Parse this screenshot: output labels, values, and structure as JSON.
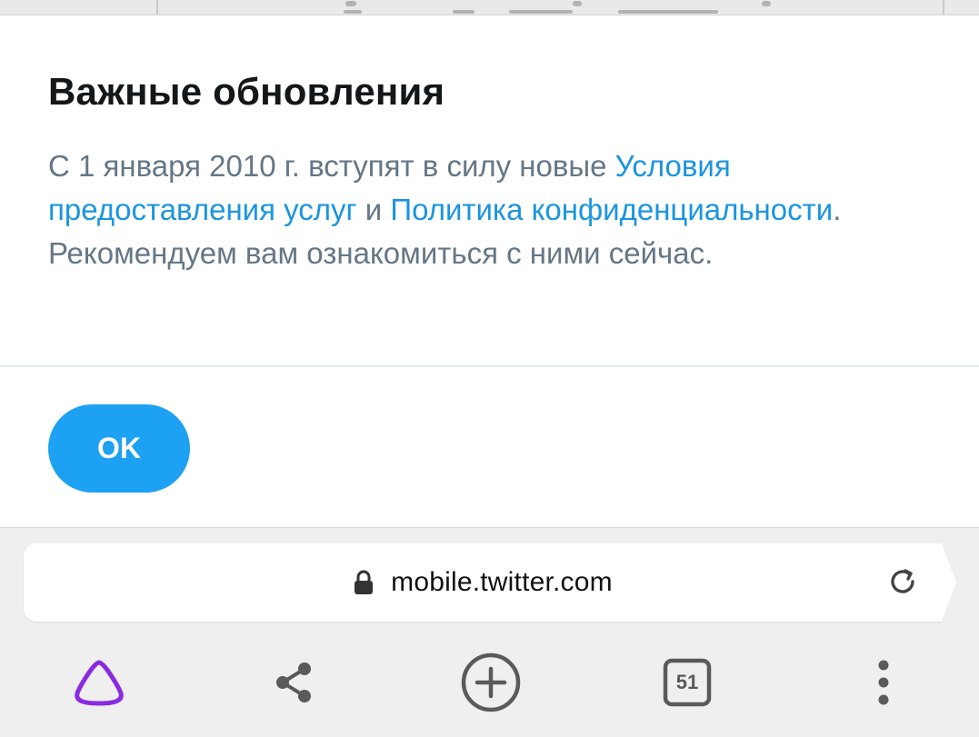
{
  "dialog": {
    "title": "Важные обновления",
    "body_pre": "С 1 января 2010 г. вступят в силу новые ",
    "terms_link": "Условия предоставления услуг",
    "body_and": " и ",
    "privacy_link": "Политика конфиденциальности",
    "body_post": ". Рекомендуем вам ознакомиться с ними сейчас.",
    "ok_label": "OK"
  },
  "browser": {
    "url": "mobile.twitter.com",
    "tab_count": "51",
    "icons": {
      "lock": "lock-icon",
      "reload": "reload-icon",
      "assistant": "alice-assistant-icon",
      "share": "share-icon",
      "new_tab": "plus-circle-icon",
      "tabs": "tabs-counter-icon",
      "menu": "more-vertical-icon"
    }
  },
  "colors": {
    "link": "#1b95e0",
    "button": "#1da1f2",
    "title": "#14171a",
    "body_text": "#657786",
    "assistant": "#8a2be2"
  }
}
